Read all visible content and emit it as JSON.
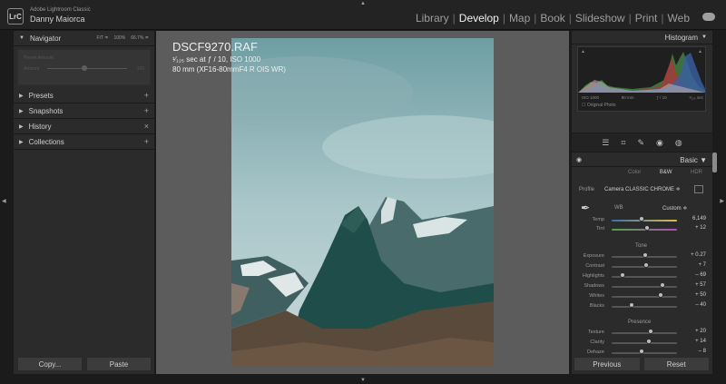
{
  "app": {
    "logo": "LrC",
    "name": "Adobe Lightroom Classic",
    "user": "Danny Maiorca"
  },
  "modules": [
    "Library",
    "Develop",
    "Map",
    "Book",
    "Slideshow",
    "Print",
    "Web"
  ],
  "active_module": "Develop",
  "left_panel": {
    "navigator": {
      "label": "Navigator",
      "zoom_options": [
        "FIT ≑",
        "100%",
        "66.7% ≑"
      ]
    },
    "preview_lines": [
      "Preset Amount",
      "Amount"
    ],
    "preview_value": "100",
    "sections": [
      {
        "label": "Presets",
        "action": "+"
      },
      {
        "label": "Snapshots",
        "action": "+"
      },
      {
        "label": "History",
        "action": "×"
      },
      {
        "label": "Collections",
        "action": "+"
      }
    ],
    "copy_label": "Copy...",
    "paste_label": "Paste"
  },
  "photo": {
    "filename": "DSCF9270.RAF",
    "exposure": "¹⁄₁₂₅ sec at ƒ / 10, ISO 1000",
    "lens": "80 mm (XF16-80mmF4 R OIS WR)"
  },
  "right_panel": {
    "histogram_label": "Histogram",
    "hist_info": [
      "ISO 1000",
      "80 mm",
      "ƒ / 10",
      "¹⁄₁₂₅ sec"
    ],
    "original_photo": "Original Photo",
    "basic_label": "Basic",
    "treatment": [
      "Color",
      "B&W",
      "HDR"
    ],
    "treatment_selected": "B&W",
    "profile_label": "Profile",
    "profile_value": "Camera CLASSIC CHROME",
    "wb_label": "WB",
    "wb_value": "Custom",
    "tone_label": "Tone",
    "presence_label": "Presence",
    "sliders_wb": [
      {
        "label": "Temp",
        "value": "6,149",
        "pos": 0.46
      },
      {
        "label": "Tint",
        "value": "+ 12",
        "pos": 0.54
      }
    ],
    "sliders_tone": [
      {
        "label": "Exposure",
        "value": "+ 0.27",
        "pos": 0.52
      },
      {
        "label": "Contrast",
        "value": "+ 7",
        "pos": 0.53
      },
      {
        "label": "Highlights",
        "value": "– 69",
        "pos": 0.16
      },
      {
        "label": "Shadows",
        "value": "+ 57",
        "pos": 0.78
      },
      {
        "label": "Whites",
        "value": "+ 50",
        "pos": 0.75
      },
      {
        "label": "Blacks",
        "value": "– 40",
        "pos": 0.3
      }
    ],
    "sliders_presence": [
      {
        "label": "Texture",
        "value": "+ 20",
        "pos": 0.6
      },
      {
        "label": "Clarity",
        "value": "+ 14",
        "pos": 0.57
      },
      {
        "label": "Dehaze",
        "value": "– 8",
        "pos": 0.46
      }
    ],
    "previous_label": "Previous",
    "reset_label": "Reset"
  },
  "colors": {
    "panel_bg": "#2b2b2b",
    "centre_bg": "#5c5c5c",
    "active_text": "#f2f2f2",
    "temp_gradient": [
      "#3b6fb0",
      "#d9c14a"
    ],
    "tint_gradient": [
      "#4fa34f",
      "#b04fb0"
    ]
  }
}
